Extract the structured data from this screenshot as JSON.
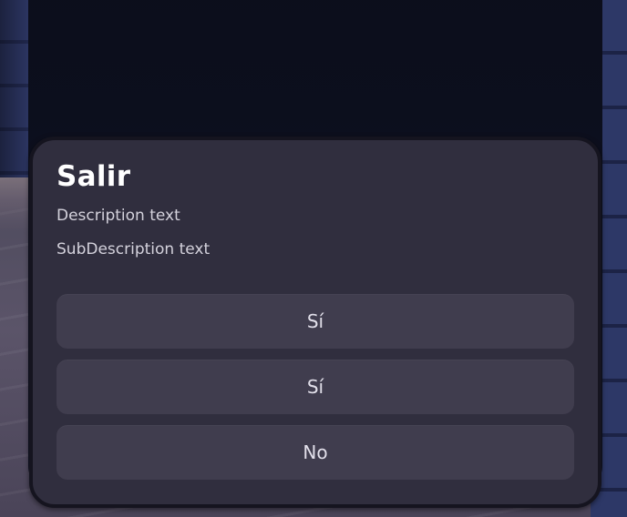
{
  "dialog": {
    "title": "Salir",
    "description": "Description text",
    "subdescription": "SubDescription text",
    "buttons": [
      {
        "label": "Sí"
      },
      {
        "label": "Sí"
      },
      {
        "label": "No"
      }
    ]
  },
  "colors": {
    "dialog_background": "#302e3e",
    "dialog_border": "#15141f",
    "button_background": "#403d4e",
    "title_text": "#ffffff",
    "body_text": "#d4d2dc"
  }
}
